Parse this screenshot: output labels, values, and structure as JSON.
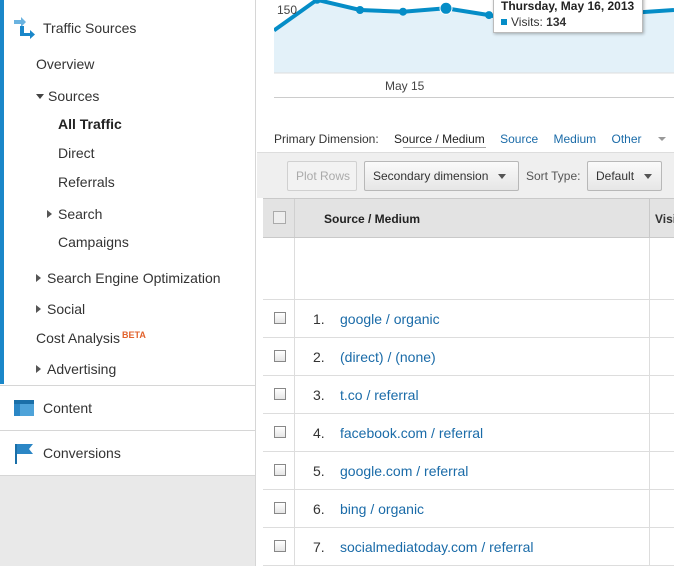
{
  "sidebar": {
    "traffic_sources": "Traffic Sources",
    "overview": "Overview",
    "sources": "Sources",
    "all_traffic": "All Traffic",
    "direct": "Direct",
    "referrals": "Referrals",
    "search": "Search",
    "campaigns": "Campaigns",
    "seo": "Search Engine Optimization",
    "social": "Social",
    "cost_analysis": "Cost Analysis",
    "beta": "BETA",
    "advertising": "Advertising",
    "content": "Content",
    "conversions": "Conversions"
  },
  "chart": {
    "y_tick": "150",
    "x_tick": "May 15",
    "tooltip_date": "Thursday, May 16, 2013",
    "tooltip_label": "Visits:",
    "tooltip_value": "134",
    "line_color": "#058dc7",
    "fill_color": "#e3f1f9"
  },
  "chart_data": {
    "type": "area",
    "series": [
      {
        "name": "Visits",
        "values": [
          138,
          156,
          150,
          149,
          151,
          147,
          141,
          146,
          150
        ]
      }
    ],
    "x_labels": [
      "",
      "",
      "",
      "May 15",
      "",
      "",
      "",
      "",
      ""
    ],
    "y_ticks": [
      150
    ]
  },
  "dimensions": {
    "label": "Primary Dimension:",
    "current": "Source / Medium",
    "source": "Source",
    "medium": "Medium",
    "other": "Other"
  },
  "toolbar": {
    "plot_rows": "Plot Rows",
    "secondary": "Secondary dimension",
    "sort_label": "Sort Type:",
    "sort_value": "Default"
  },
  "table": {
    "col_source": "Source / Medium",
    "col_visits": "Visi",
    "rows": [
      {
        "num": "1.",
        "source": "google / organic"
      },
      {
        "num": "2.",
        "source": "(direct) / (none)"
      },
      {
        "num": "3.",
        "source": "t.co / referral"
      },
      {
        "num": "4.",
        "source": "facebook.com / referral"
      },
      {
        "num": "5.",
        "source": "google.com / referral"
      },
      {
        "num": "6.",
        "source": "bing / organic"
      },
      {
        "num": "7.",
        "source": "socialmediatoday.com / referral"
      }
    ]
  }
}
